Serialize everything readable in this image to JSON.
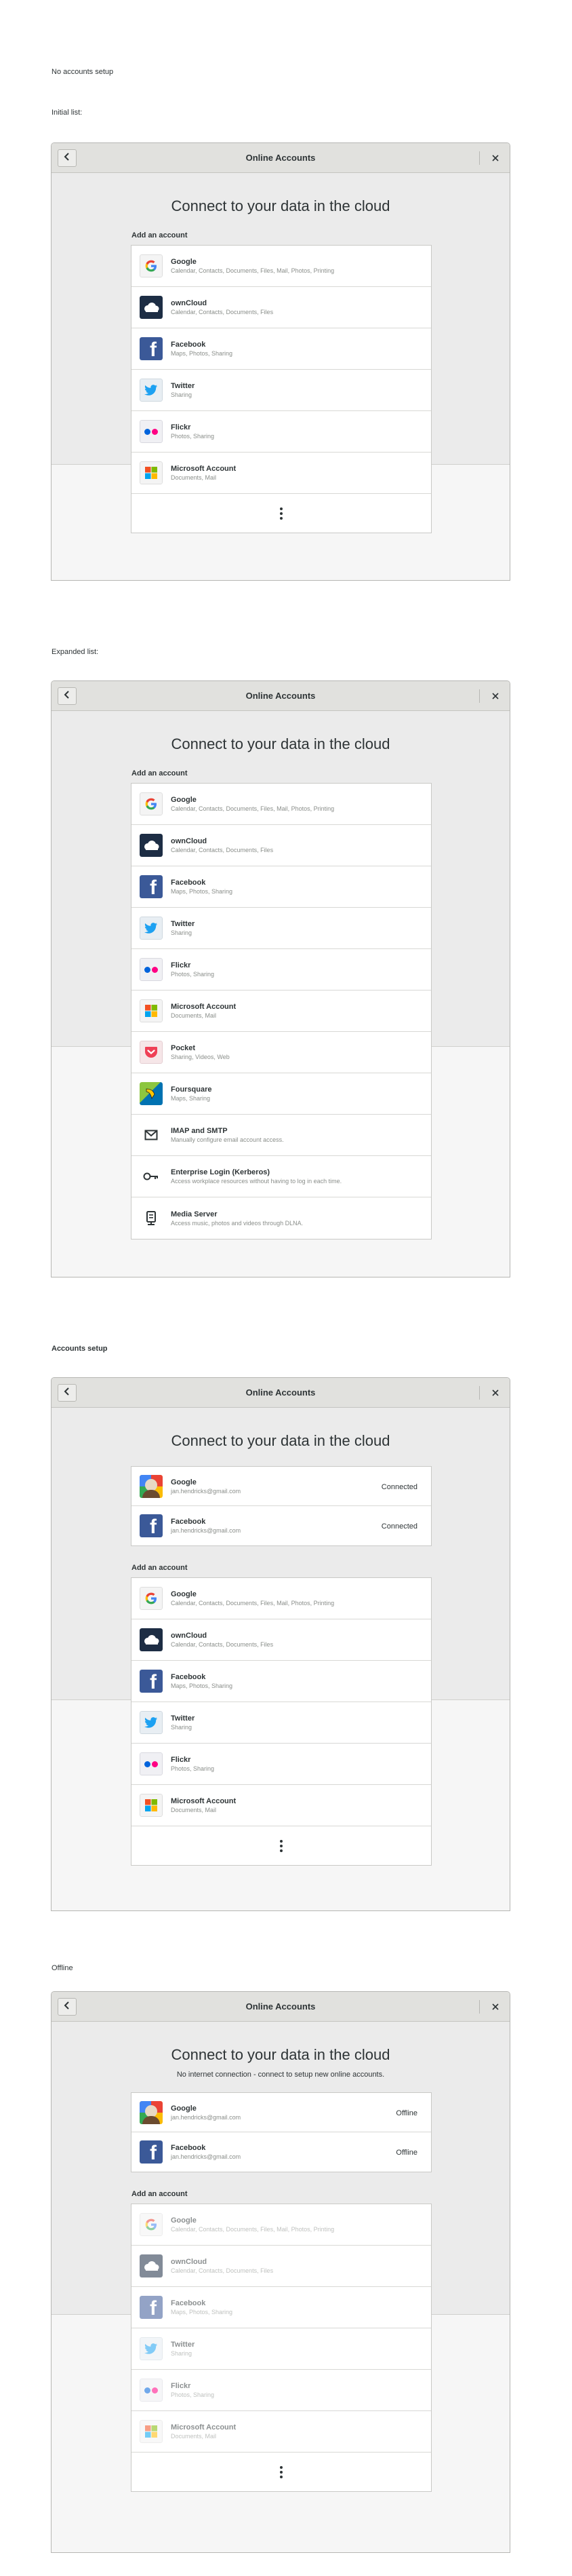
{
  "window_title": "Online Accounts",
  "heading": "Connect to your data in the cloud",
  "add_label": "Add an account",
  "offline_message": "No internet connection - connect to setup new online accounts.",
  "sections": {
    "s1": "No accounts setup",
    "s1_sub": "Initial list:",
    "s2_sub": "Expanded list:",
    "s3": "Accounts setup",
    "s4": "Offline"
  },
  "providers": [
    {
      "name": "Google",
      "desc": "Calendar, Contacts, Documents, Files, Mail, Photos, Printing",
      "icon": "google-icon"
    },
    {
      "name": "ownCloud",
      "desc": "Calendar, Contacts, Documents, Files",
      "icon": "owncloud-icon"
    },
    {
      "name": "Facebook",
      "desc": "Maps, Photos, Sharing",
      "icon": "facebook-icon"
    },
    {
      "name": "Twitter",
      "desc": "Sharing",
      "icon": "twitter-icon"
    },
    {
      "name": "Flickr",
      "desc": "Photos, Sharing",
      "icon": "flickr-icon"
    },
    {
      "name": "Microsoft Account",
      "desc": "Documents, Mail",
      "icon": "microsoft-icon"
    },
    {
      "name": "Pocket",
      "desc": "Sharing, Videos, Web",
      "icon": "pocket-icon"
    },
    {
      "name": "Foursquare",
      "desc": "Maps, Sharing",
      "icon": "foursquare-icon"
    },
    {
      "name": "IMAP and SMTP",
      "desc": "Manually configure email account access.",
      "icon": "mail-icon"
    },
    {
      "name": "Enterprise Login (Kerberos)",
      "desc": "Access workplace resources without having to log in each time.",
      "icon": "key-icon"
    },
    {
      "name": "Media Server",
      "desc": "Access music, photos and videos through DLNA.",
      "icon": "media-server-icon"
    }
  ],
  "accounts": [
    {
      "name": "Google",
      "email": "jan.hendricks@gmail.com",
      "status": "Connected",
      "offline_status": "Offline",
      "icon": "google-account-icon"
    },
    {
      "name": "Facebook",
      "email": "jan.hendricks@gmail.com",
      "status": "Connected",
      "offline_status": "Offline",
      "icon": "facebook-icon"
    }
  ]
}
